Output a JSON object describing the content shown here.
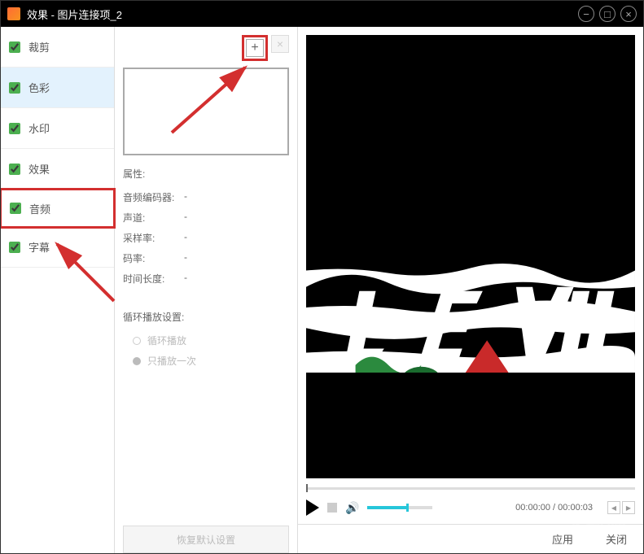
{
  "titlebar": {
    "title": "效果 - 图片连接项_2"
  },
  "sidebar": {
    "items": [
      {
        "label": "裁剪",
        "checked": true,
        "selected": false,
        "highlighted": false
      },
      {
        "label": "色彩",
        "checked": true,
        "selected": true,
        "highlighted": false
      },
      {
        "label": "水印",
        "checked": true,
        "selected": false,
        "highlighted": false
      },
      {
        "label": "效果",
        "checked": true,
        "selected": false,
        "highlighted": false
      },
      {
        "label": "音频",
        "checked": true,
        "selected": false,
        "highlighted": true
      },
      {
        "label": "字幕",
        "checked": true,
        "selected": false,
        "highlighted": false
      }
    ]
  },
  "middle": {
    "props_label": "属性:",
    "props": [
      {
        "label": "音频编码器:",
        "value": "-"
      },
      {
        "label": "声道:",
        "value": "-"
      },
      {
        "label": "采样率:",
        "value": "-"
      },
      {
        "label": "码率:",
        "value": "-"
      },
      {
        "label": "时间长度:",
        "value": "-"
      }
    ],
    "loop_label": "循环播放设置:",
    "loop_options": [
      {
        "label": "循环播放",
        "selected": false
      },
      {
        "label": "只播放一次",
        "selected": true
      }
    ],
    "restore_label": "恢复默认设置"
  },
  "player": {
    "time_current": "00:00:00",
    "time_total": "00:00:03"
  },
  "bottom": {
    "apply_label": "应用",
    "close_label": "关闭"
  }
}
